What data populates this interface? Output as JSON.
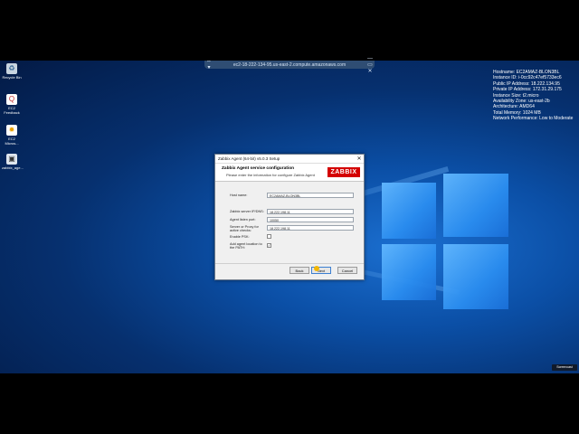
{
  "remote_bar": {
    "title": "ec2-18-222-134-95.us-east-2.compute.amazonaws.com",
    "left_icons": "⇔ ▾",
    "right_icons": "— ▭ ✕"
  },
  "desktop_icons": [
    {
      "label": "Recycle Bin",
      "icon": "recycle-bin-icon"
    },
    {
      "label": "EC2 Feedback",
      "icon": "feedback-icon"
    },
    {
      "label": "EC2 Micros...",
      "icon": "ec2-icon"
    },
    {
      "label": "zabbix_age...",
      "icon": "installer-icon"
    }
  ],
  "instance_info": {
    "hostname": "Hostname: EC2AMAZ-BLON3BL",
    "instance_id": "Instance ID: i-0cc92c47ef5733ec6",
    "public_ip": "Public IP Address: 18.222.134.95",
    "private_ip": "Private IP Address: 172.31.29.175",
    "instance_size": "Instance Size: t2.micro",
    "availability_zone": "Availability Zone: us-east-2b",
    "architecture": "Architecture: AMD64",
    "memory": "Total Memory: 1024 MB",
    "network": "Network Performance: Low to Moderate"
  },
  "dialog": {
    "title": "Zabbix Agent (64-bit) v5.0.3 Setup",
    "close": "✕",
    "heading": "Zabbix Agent service configuration",
    "subheading": "Please enter the information for configure Zabbix Agent",
    "logo": "ZABBIX",
    "fields": {
      "host_name_label": "Host name:",
      "host_name_value": "EC2AMAZ-BLON3BL",
      "server_label": "Zabbix server IP/DNS:",
      "server_value": "18.222.198.11",
      "port_label": "Agent listen port:",
      "port_value": "10050",
      "active_label": "Server or Proxy for active checks:",
      "active_value": "18.222.198.11",
      "psk_label": "Enable PSK:",
      "psk_checked": false,
      "path_label": "Add agent location to the PATH:",
      "path_checked": true,
      "check_mark": "✓"
    },
    "buttons": {
      "back": "Back",
      "next": "Next",
      "cancel": "Cancel"
    }
  },
  "watermark": "Screencast"
}
